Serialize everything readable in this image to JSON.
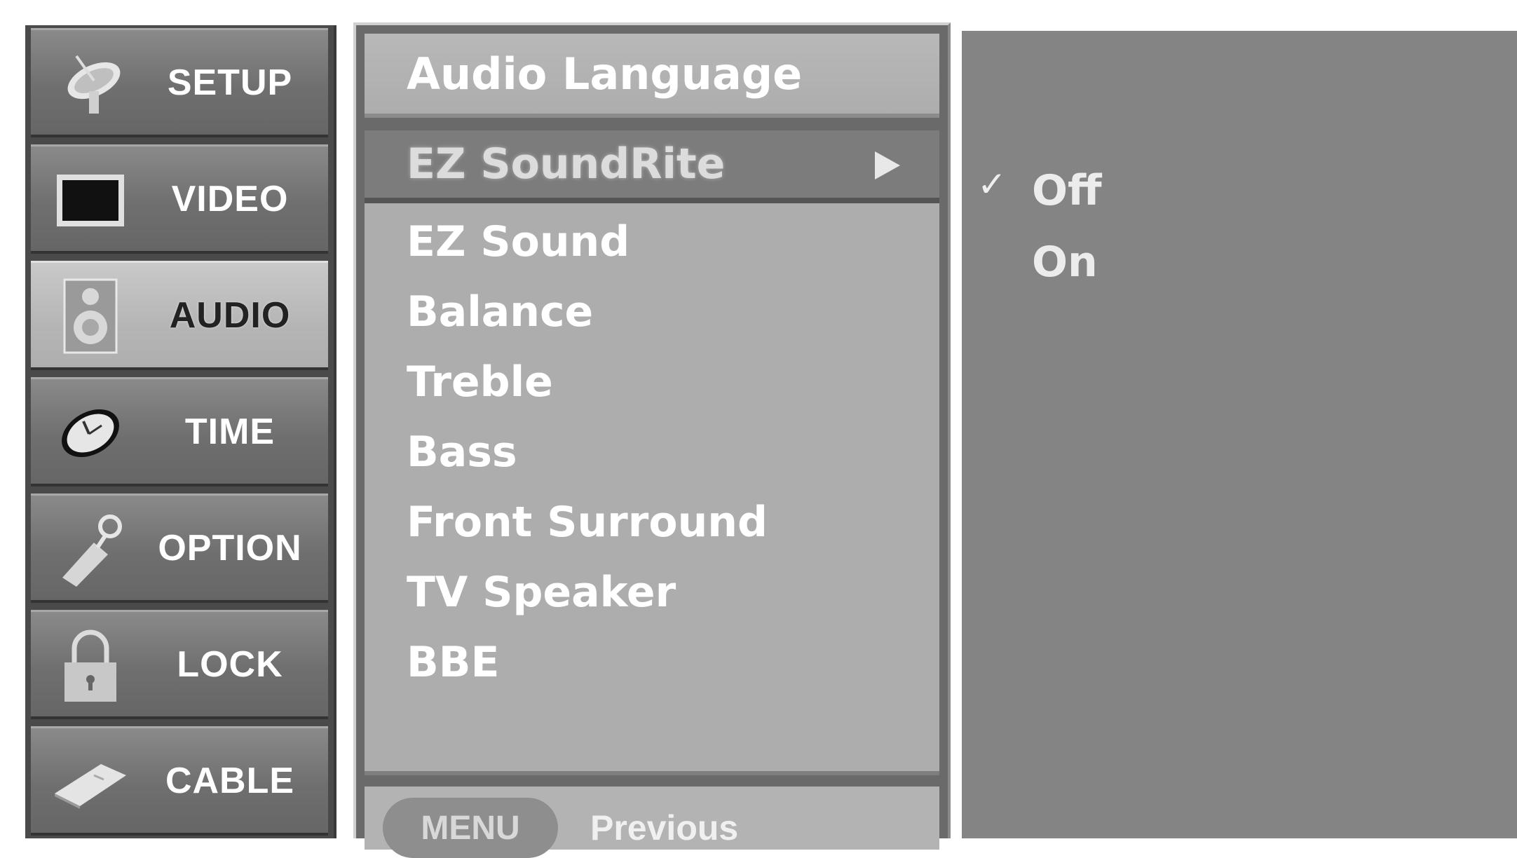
{
  "sidebar": {
    "items": [
      {
        "label": "SETUP",
        "icon": "satellite-dish-icon",
        "active": false
      },
      {
        "label": "VIDEO",
        "icon": "tv-screen-icon",
        "active": false
      },
      {
        "label": "AUDIO",
        "icon": "speaker-icon",
        "active": true
      },
      {
        "label": "TIME",
        "icon": "clock-icon",
        "active": false
      },
      {
        "label": "OPTION",
        "icon": "tag-key-icon",
        "active": false
      },
      {
        "label": "LOCK",
        "icon": "padlock-icon",
        "active": false
      },
      {
        "label": "CABLE",
        "icon": "cable-card-icon",
        "active": false
      }
    ]
  },
  "menu": {
    "title": "Audio Language",
    "items": [
      {
        "label": "EZ SoundRite",
        "selected": true
      },
      {
        "label": "EZ Sound",
        "selected": false
      },
      {
        "label": "Balance",
        "selected": false
      },
      {
        "label": "Treble",
        "selected": false
      },
      {
        "label": "Bass",
        "selected": false
      },
      {
        "label": "Front Surround",
        "selected": false
      },
      {
        "label": "TV Speaker",
        "selected": false
      },
      {
        "label": "BBE",
        "selected": false
      }
    ],
    "footer": {
      "button_label": "MENU",
      "hint_label": "Previous"
    }
  },
  "submenu": {
    "options": [
      {
        "label": "Off",
        "checked": true
      },
      {
        "label": "On",
        "checked": false
      }
    ],
    "check_mark": "✓"
  },
  "colors": {
    "sidebar_bg": "#4a4a4a",
    "menu_bg": "#adadad",
    "selected_bg": "#7c7c7c",
    "submenu_bg": "#848484"
  }
}
